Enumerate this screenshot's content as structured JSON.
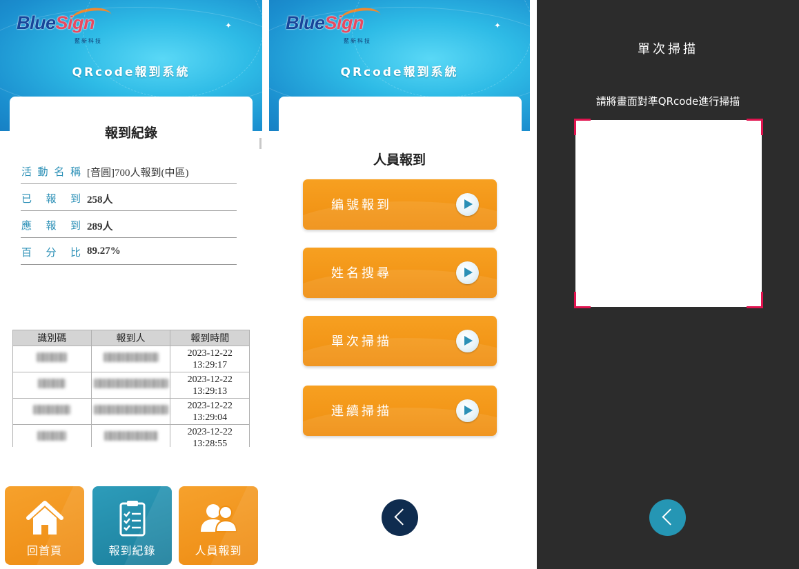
{
  "brand": {
    "logo_blue": "Blue",
    "logo_red": "Sign",
    "logo_sub": "藍新科技"
  },
  "header_title": "QRcode報到系統",
  "record_screen": {
    "title": "報到紀錄",
    "info": [
      {
        "label": "活動名稱",
        "value": "[音圓]700人報到(中區)"
      },
      {
        "label": "已報到",
        "value": "258人"
      },
      {
        "label": "應報到",
        "value": "289人"
      },
      {
        "label": "百分比",
        "value": "89.27%"
      }
    ],
    "table": {
      "headers": [
        "識別碼",
        "報到人",
        "報到時間"
      ],
      "rows": [
        {
          "date": "2023-12-22",
          "time": "13:29:17"
        },
        {
          "date": "2023-12-22",
          "time": "13:29:13"
        },
        {
          "date": "2023-12-22",
          "time": "13:29:04"
        },
        {
          "date": "2023-12-22",
          "time": "13:28:55"
        }
      ]
    },
    "nav": [
      {
        "label": "回首頁",
        "icon": "home-icon"
      },
      {
        "label": "報到紀錄",
        "icon": "clipboard-icon"
      },
      {
        "label": "人員報到",
        "icon": "people-icon"
      }
    ]
  },
  "checkin_screen": {
    "title": "人員報到",
    "buttons": [
      {
        "label": "編號報到",
        "icon": "play-icon"
      },
      {
        "label": "姓名搜尋",
        "icon": "play-icon"
      },
      {
        "label": "單次掃描",
        "icon": "play-icon"
      },
      {
        "label": "連續掃描",
        "icon": "play-icon"
      }
    ],
    "back_icon": "back-arrow-icon"
  },
  "scan_screen": {
    "title": "單次掃描",
    "instruction": "請將畫面對準QRcode進行掃描",
    "back_icon": "back-arrow-icon"
  },
  "colors": {
    "orange": "#f39a1d",
    "teal": "#2596b4",
    "navy": "#0f2c4f",
    "label_blue": "#2a8fb6",
    "scanner_corner": "#e0134f",
    "dark_bg": "#2c2c2c"
  }
}
